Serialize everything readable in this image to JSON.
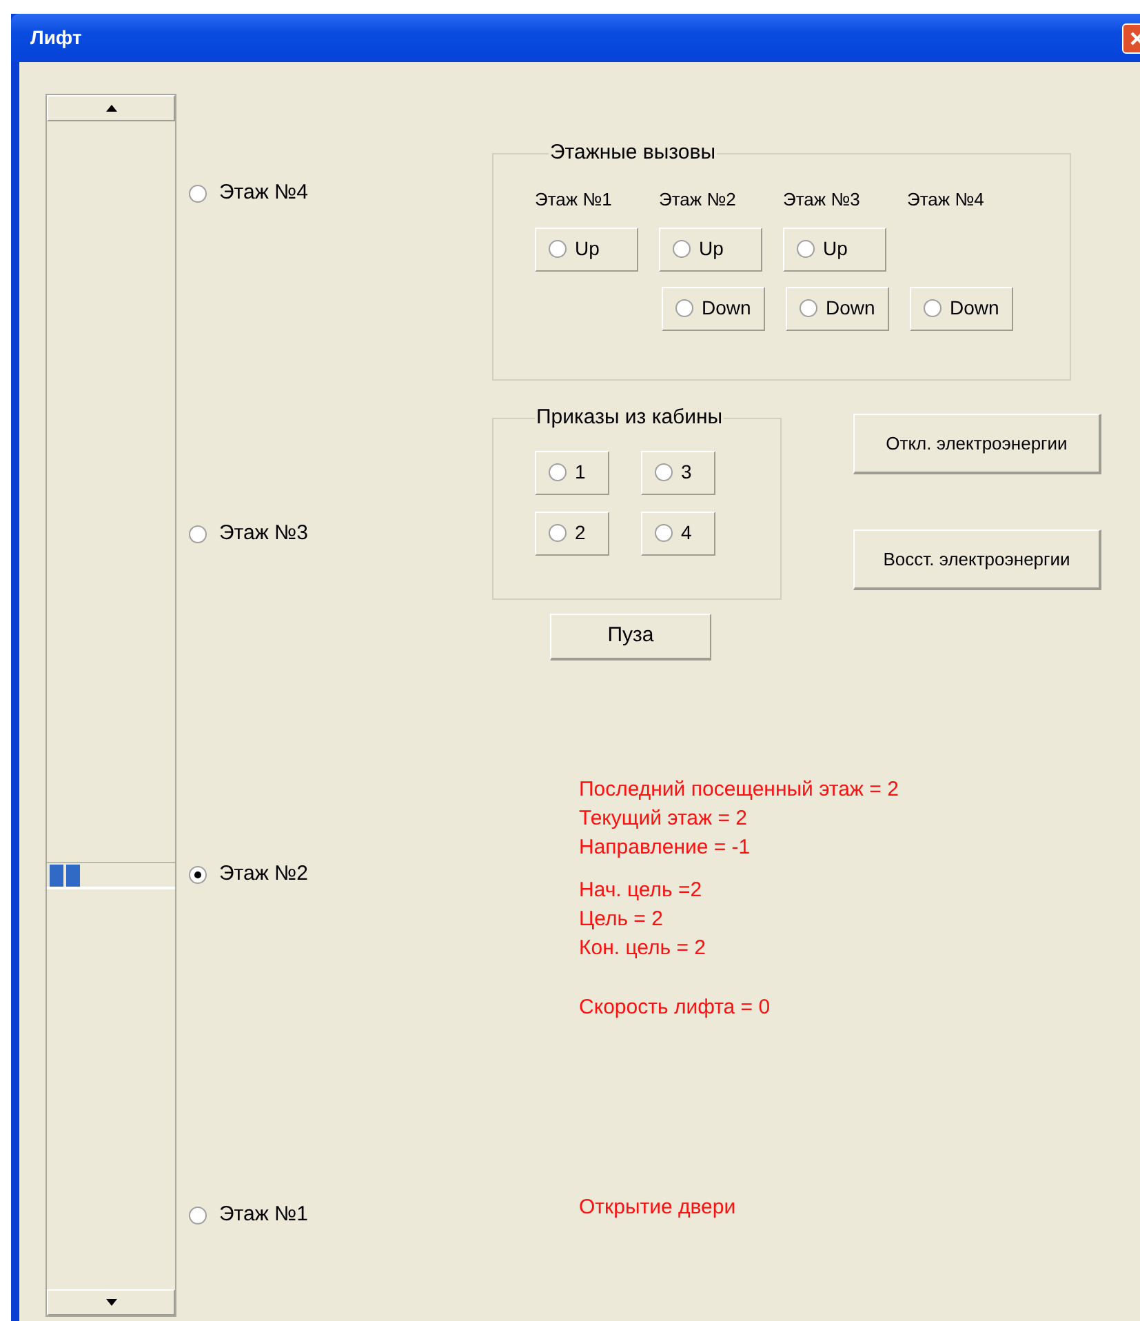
{
  "window": {
    "title": "Лифт"
  },
  "floors": [
    {
      "label": "Этаж №4",
      "selected": false
    },
    {
      "label": "Этаж №3",
      "selected": false
    },
    {
      "label": "Этаж №2",
      "selected": true
    },
    {
      "label": "Этаж №1",
      "selected": false
    }
  ],
  "floor_calls": {
    "title": "Этажные вызовы",
    "columns": [
      {
        "label": "Этаж №1",
        "buttons": [
          {
            "kind": "up",
            "label": "Up",
            "selected": false
          }
        ]
      },
      {
        "label": "Этаж №2",
        "buttons": [
          {
            "kind": "up",
            "label": "Up",
            "selected": false
          },
          {
            "kind": "down",
            "label": "Down",
            "selected": false
          }
        ]
      },
      {
        "label": "Этаж №3",
        "buttons": [
          {
            "kind": "up",
            "label": "Up",
            "selected": false
          },
          {
            "kind": "down",
            "label": "Down",
            "selected": false
          }
        ]
      },
      {
        "label": "Этаж №4",
        "buttons": [
          {
            "kind": "down",
            "label": "Down",
            "selected": false
          }
        ]
      }
    ]
  },
  "cabin_orders": {
    "title": "Приказы из кабины",
    "buttons": [
      {
        "label": "1",
        "selected": false
      },
      {
        "label": "3",
        "selected": false
      },
      {
        "label": "2",
        "selected": false
      },
      {
        "label": "4",
        "selected": false
      }
    ]
  },
  "power_buttons": [
    "Откл. электроэнергии",
    "Восст. электроэнергии"
  ],
  "pause_button": "Пуза",
  "status_groups": [
    [
      "Последний посещенный этаж = 2",
      "Текущий этаж = 2",
      "Направление = -1"
    ],
    [
      "Нач. цель =2",
      "Цель = 2",
      "Кон. цель = 2"
    ],
    [
      "Скорость лифта = 0"
    ]
  ],
  "door_status": "Открытие двери"
}
